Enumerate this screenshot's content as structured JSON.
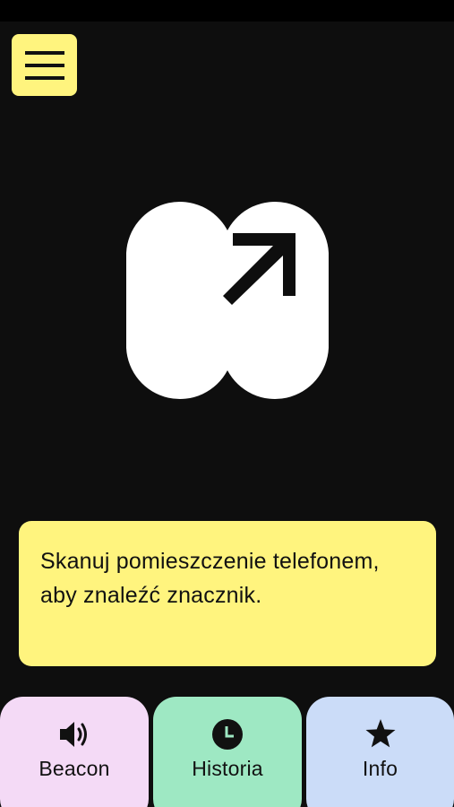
{
  "colors": {
    "background": "#0e0e0e",
    "status_bar": "#000000",
    "accent_yellow": "#fff47e",
    "logo": "#ffffff",
    "nav_beacon": "#f4daf6",
    "nav_history": "#9ee8c3",
    "nav_info": "#cbdcf8"
  },
  "menu": {
    "icon": "hamburger-menu-icon"
  },
  "logo": {
    "icon": "app-logo-arrow-icon"
  },
  "instruction": {
    "text": "Skanuj pomieszczenie telefonem, aby znaleźć znacznik."
  },
  "nav": {
    "items": [
      {
        "label": "Beacon",
        "icon": "speaker-icon"
      },
      {
        "label": "Historia",
        "icon": "clock-icon"
      },
      {
        "label": "Info",
        "icon": "star-icon"
      }
    ]
  }
}
